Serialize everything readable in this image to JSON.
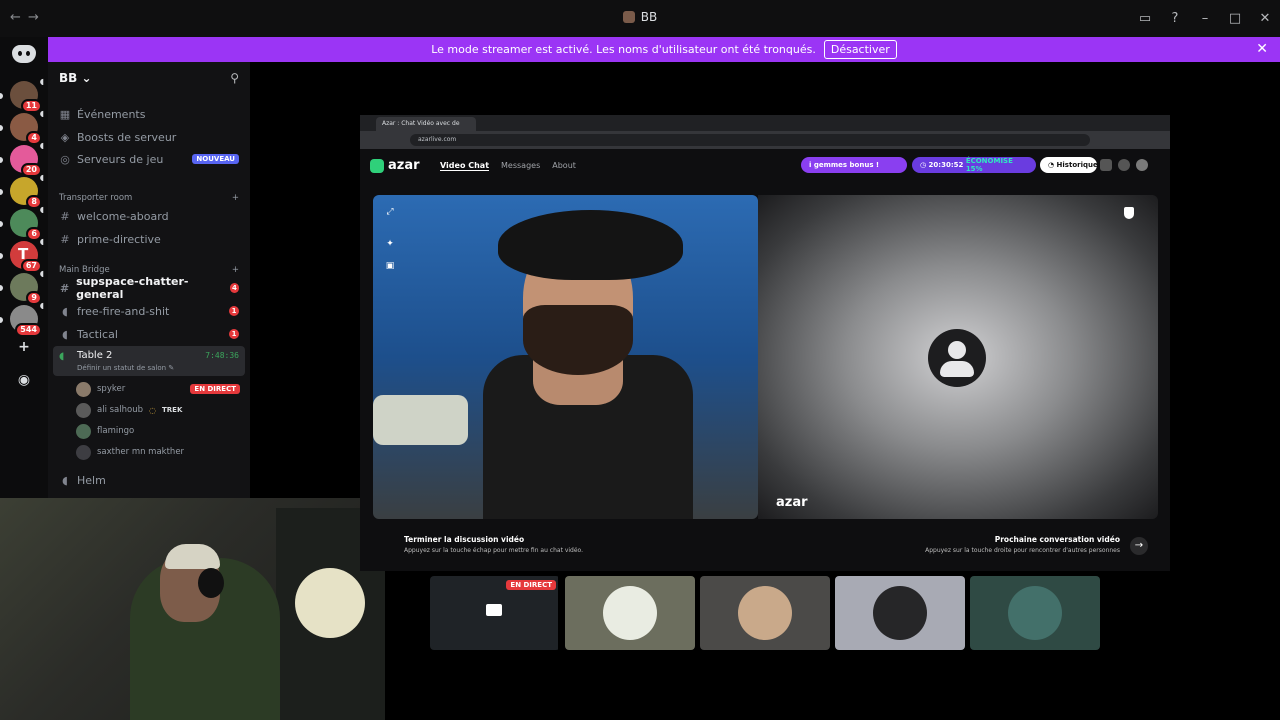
{
  "window": {
    "title": "BB"
  },
  "banner": {
    "text": "Le mode streamer est activé. Les noms d'utilisateur ont été tronqués.",
    "button": "Désactiver"
  },
  "servers": [
    {
      "badge": "11",
      "color": "#6b4f3d"
    },
    {
      "badge": "4",
      "color": "#8a5a44"
    },
    {
      "badge": "20",
      "color": "#e45a9a"
    },
    {
      "badge": "8",
      "color": "#c7a62b"
    },
    {
      "badge": "6",
      "color": "#4d8a5a"
    },
    {
      "badge": "67",
      "color": "#d23c3c",
      "letter": "T"
    },
    {
      "badge": "9",
      "color": "#6d7a5c"
    },
    {
      "badge": "544",
      "color": "#8a8a8a"
    }
  ],
  "sidebar": {
    "server_name": "BB",
    "top_items": [
      {
        "label": "Événements"
      },
      {
        "label": "Boosts de serveur"
      },
      {
        "label": "Serveurs de jeu",
        "badge": "NOUVEAU"
      }
    ],
    "cat1": {
      "label": "Transporter room"
    },
    "cat1_channels": [
      {
        "label": "welcome-aboard"
      },
      {
        "label": "prime-directive"
      }
    ],
    "cat2": {
      "label": "Main Bridge"
    },
    "cat2_channels": [
      {
        "label": "supspace-chatter-general",
        "count": "4"
      },
      {
        "label": "free-fire-and-shit",
        "count": "1"
      },
      {
        "label": "Tactical",
        "count": "1"
      }
    ],
    "active_voice": {
      "name": "Table 2",
      "time": "7:48:36",
      "status": "Définir un statut de salon"
    },
    "voice_users": [
      {
        "name": "spyker",
        "live": "EN DIRECT"
      },
      {
        "name": "ali salhoub",
        "tag": "TREK"
      },
      {
        "name": "flamingo"
      },
      {
        "name": "saxther mn makther"
      }
    ],
    "helm": {
      "label": "Helm"
    }
  },
  "browser": {
    "tab": "Azar : Chat Vidéo avec de",
    "url": "azarlive.com"
  },
  "azar": {
    "logo": "azar",
    "nav": [
      "Video Chat",
      "Messages",
      "About"
    ],
    "gems": "i gemmes bonus !",
    "timer": "20:30:52",
    "save": "ÉCONOMISE 15%",
    "history": "Historique",
    "watermark": "azar",
    "end_title": "Terminer la discussion vidéo",
    "end_sub": "Appuyez sur la touche échap pour mettre fin au chat vidéo.",
    "next_title": "Prochaine conversation vidéo",
    "next_sub": "Appuyez sur la touche droite pour rencontrer d'autres personnes"
  },
  "tiles": {
    "live": "EN DIRECT"
  }
}
